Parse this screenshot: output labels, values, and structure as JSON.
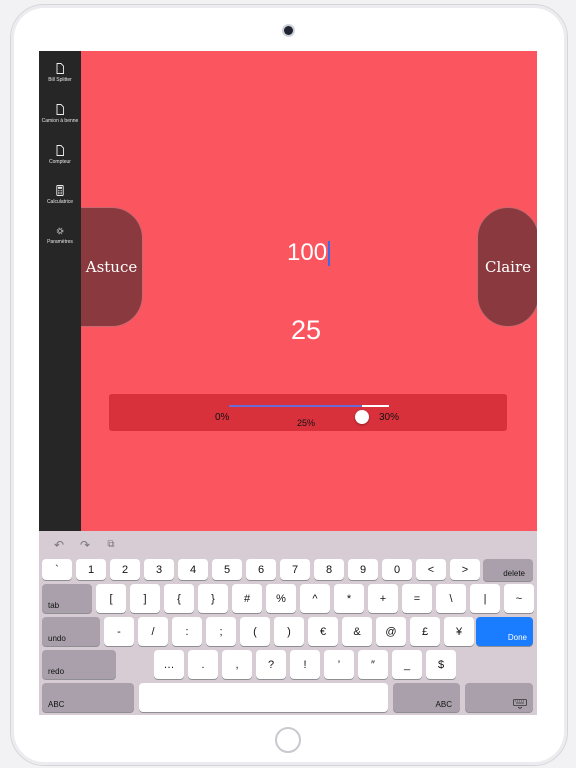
{
  "sidebar": {
    "items": [
      {
        "label": "Bill Splitter",
        "icon": "document-icon"
      },
      {
        "label": "Camion à benne",
        "icon": "document-icon"
      },
      {
        "label": "Compteur",
        "icon": "document-icon"
      },
      {
        "label": "Calculatrice",
        "icon": "calculator-icon"
      },
      {
        "label": "Paramètres",
        "icon": "gear-icon"
      }
    ]
  },
  "main": {
    "left_button": "Astuce",
    "right_button": "Claire",
    "amount_value": "100",
    "tip_value": "25",
    "background_color": "#fb555f",
    "slider": {
      "min_label": "0%",
      "max_label": "30%",
      "value_label": "25%",
      "fraction": 0.8333
    }
  },
  "keyboard": {
    "toolbar": [
      "undo-arrow-icon",
      "redo-arrow-icon",
      "clipboard-icon"
    ],
    "row1": [
      "`",
      "1",
      "2",
      "3",
      "4",
      "5",
      "6",
      "7",
      "8",
      "9",
      "0",
      "<",
      ">"
    ],
    "delete": "delete",
    "tab": "tab",
    "row2": [
      "[",
      "]",
      "{",
      "}",
      "#",
      "%",
      "^",
      "*",
      "+",
      "=",
      "\\",
      "|",
      "~"
    ],
    "undo": "undo",
    "row3": [
      "-",
      "/",
      ":",
      ";",
      "(",
      ")",
      "€",
      "&",
      "@",
      "£",
      "¥"
    ],
    "done": "Done",
    "redo": "redo",
    "row4": [
      "…",
      ".",
      ",",
      "?",
      "!",
      "’",
      "″",
      "_",
      "$"
    ],
    "abc_left": "ABC",
    "abc_right": "ABC",
    "dismiss_icon": "keyboard-dismiss-icon",
    "accent": "#1a7cff"
  }
}
